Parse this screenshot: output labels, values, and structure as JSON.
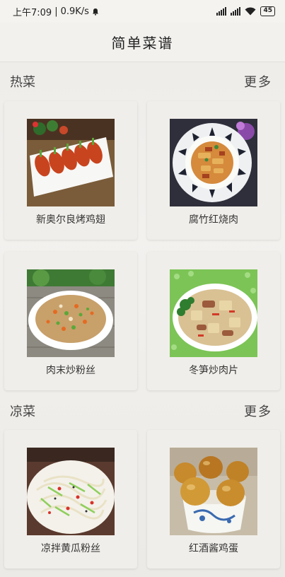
{
  "status_bar": {
    "time": "上午7:09",
    "speed": "0.9K/s",
    "battery": "45"
  },
  "header": {
    "title": "简单菜谱"
  },
  "sections": [
    {
      "title": "热菜",
      "more_label": "更多",
      "items": [
        {
          "name": "新奥尔良烤鸡翅",
          "photo_icon": "grilled-chicken-wings"
        },
        {
          "name": "腐竹红烧肉",
          "photo_icon": "braised-pork-yuba"
        },
        {
          "name": "肉末炒粉丝",
          "photo_icon": "stir-fried-vermicelli"
        },
        {
          "name": "冬笋炒肉片",
          "photo_icon": "bamboo-shoot-pork"
        }
      ]
    },
    {
      "title": "凉菜",
      "more_label": "更多",
      "items": [
        {
          "name": "凉拌黄瓜粉丝",
          "photo_icon": "cucumber-vermicelli-salad"
        },
        {
          "name": "红酒酱鸡蛋",
          "photo_icon": "wine-marinated-eggs"
        }
      ]
    }
  ]
}
